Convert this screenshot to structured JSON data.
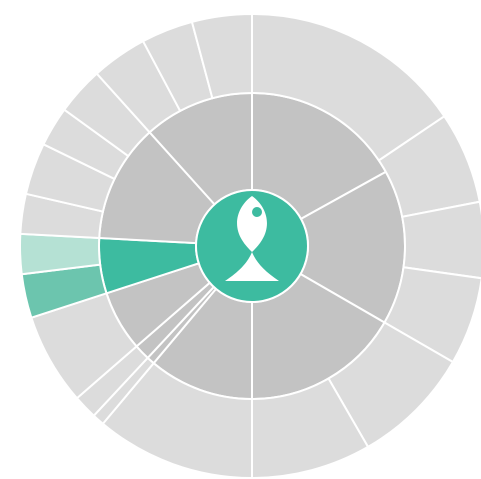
{
  "chart_data": {
    "type": "sunburst",
    "title": "",
    "colors": {
      "inactive_inner": "#c3c3c3",
      "inactive_outer": "#dcdcdc",
      "highlight_inner": "#3dbba0",
      "highlight_outer_a": "#b5e1d4",
      "highlight_outer_b": "#6cc5ae",
      "center": "#3dbba0",
      "separator": "#ffffff",
      "icon": "#ffffff"
    },
    "center_icon": "fish-icon",
    "rings": [
      {
        "name": "inner",
        "segments": [
          {
            "id": "inner-1",
            "start": 0,
            "end": 61,
            "highlight": false
          },
          {
            "id": "inner-2",
            "start": 61,
            "end": 120,
            "highlight": false
          },
          {
            "id": "inner-3",
            "start": 120,
            "end": 180,
            "highlight": false
          },
          {
            "id": "inner-4",
            "start": 180,
            "end": 220,
            "highlight": false
          },
          {
            "id": "inner-5",
            "start": 220,
            "end": 223,
            "highlight": false
          },
          {
            "id": "inner-6",
            "start": 223,
            "end": 229,
            "highlight": false
          },
          {
            "id": "inner-7",
            "start": 229,
            "end": 252,
            "highlight": false
          },
          {
            "id": "inner-8",
            "start": 252,
            "end": 273,
            "highlight": true
          },
          {
            "id": "inner-9",
            "start": 273,
            "end": 318,
            "highlight": false
          },
          {
            "id": "inner-10",
            "start": 318,
            "end": 360,
            "highlight": false
          }
        ]
      },
      {
        "name": "outer",
        "segments": [
          {
            "id": "outer-1",
            "start": 0,
            "end": 56,
            "highlight": false
          },
          {
            "id": "outer-2",
            "start": 56,
            "end": 79,
            "highlight": false
          },
          {
            "id": "outer-3",
            "start": 79,
            "end": 98,
            "highlight": false
          },
          {
            "id": "outer-4",
            "start": 98,
            "end": 120,
            "highlight": false
          },
          {
            "id": "outer-5",
            "start": 120,
            "end": 150,
            "highlight": false
          },
          {
            "id": "outer-6",
            "start": 150,
            "end": 180,
            "highlight": false
          },
          {
            "id": "outer-7",
            "start": 180,
            "end": 220,
            "highlight": false
          },
          {
            "id": "outer-8",
            "start": 220,
            "end": 223,
            "highlight": false
          },
          {
            "id": "outer-9",
            "start": 223,
            "end": 229,
            "highlight": false
          },
          {
            "id": "outer-10",
            "start": 229,
            "end": 252,
            "highlight": false
          },
          {
            "id": "outer-11",
            "start": 252,
            "end": 263,
            "highlight": "b"
          },
          {
            "id": "outer-12",
            "start": 263,
            "end": 273,
            "highlight": "a"
          },
          {
            "id": "outer-13",
            "start": 273,
            "end": 283,
            "highlight": false
          },
          {
            "id": "outer-14",
            "start": 283,
            "end": 296,
            "highlight": false
          },
          {
            "id": "outer-15",
            "start": 296,
            "end": 306,
            "highlight": false
          },
          {
            "id": "outer-16",
            "start": 306,
            "end": 318,
            "highlight": false
          },
          {
            "id": "outer-17",
            "start": 318,
            "end": 332,
            "highlight": false
          },
          {
            "id": "outer-18",
            "start": 332,
            "end": 345,
            "highlight": false
          },
          {
            "id": "outer-19",
            "start": 345,
            "end": 360,
            "highlight": false
          }
        ]
      }
    ]
  }
}
